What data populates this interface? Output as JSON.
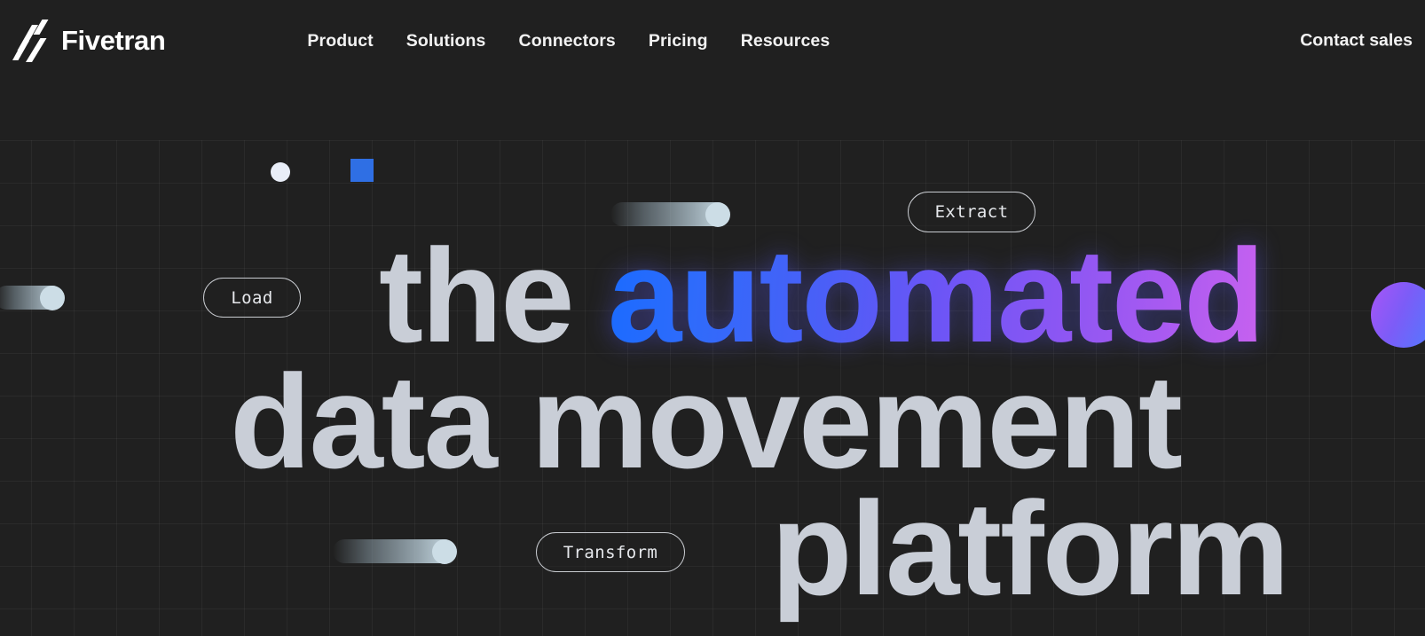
{
  "brand": {
    "name": "Fivetran",
    "logo_icon": "fivetran-bars-logo"
  },
  "nav": {
    "items": [
      {
        "label": "Product"
      },
      {
        "label": "Solutions"
      },
      {
        "label": "Connectors"
      },
      {
        "label": "Pricing"
      },
      {
        "label": "Resources"
      }
    ],
    "contact": {
      "label": "Contact sales"
    }
  },
  "hero": {
    "headline": {
      "line1_plain": "the",
      "line1_gradient": "automated",
      "line2": "data movement",
      "line3": "platform"
    },
    "pills": [
      {
        "label": "Extract"
      },
      {
        "label": "Load"
      },
      {
        "label": "Transform"
      }
    ]
  },
  "colors": {
    "background": "#202020",
    "grid_line": "#2b2b2b",
    "headline_text": "#c9ced7",
    "gradient_start": "#1a6bff",
    "gradient_mid": "#7c5cf7",
    "gradient_end": "#c862ef",
    "accent_square": "#2f6fe4",
    "trail_head": "#ccdde6",
    "nav_text": "#f2f2f2"
  }
}
